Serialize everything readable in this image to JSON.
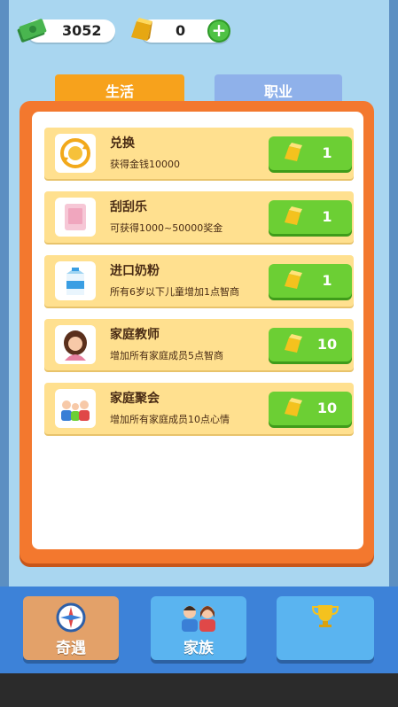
{
  "currency": {
    "money": "3052",
    "gold": "0",
    "add_label": "+"
  },
  "tabs": [
    {
      "label": "生活",
      "active": true
    },
    {
      "label": "职业",
      "active": false
    }
  ],
  "items": [
    {
      "title": "兑换",
      "desc": "获得金钱10000",
      "price": "1",
      "icon": "coin-exchange-icon"
    },
    {
      "title": "刮刮乐",
      "desc": "可获得1000~50000奖金",
      "price": "1",
      "icon": "scratch-card-icon"
    },
    {
      "title": "进口奶粉",
      "desc": "所有6岁以下儿童增加1点智商",
      "price": "1",
      "icon": "milk-carton-icon"
    },
    {
      "title": "家庭教师",
      "desc": "增加所有家庭成员5点智商",
      "price": "10",
      "icon": "teacher-avatar-icon"
    },
    {
      "title": "家庭聚会",
      "desc": "增加所有家庭成员10点心情",
      "price": "10",
      "icon": "family-gathering-icon"
    }
  ],
  "nav": [
    {
      "label": "奇遇",
      "icon": "compass-icon"
    },
    {
      "label": "家族",
      "icon": "family-icon"
    },
    {
      "label": "",
      "icon": "trophy-icon"
    }
  ],
  "colors": {
    "background": "#a9d6f0",
    "panel_orange": "#f3782e",
    "item_yellow": "#ffe08f",
    "buy_green": "#6ccf34",
    "nav_blue": "#3d82d8"
  }
}
